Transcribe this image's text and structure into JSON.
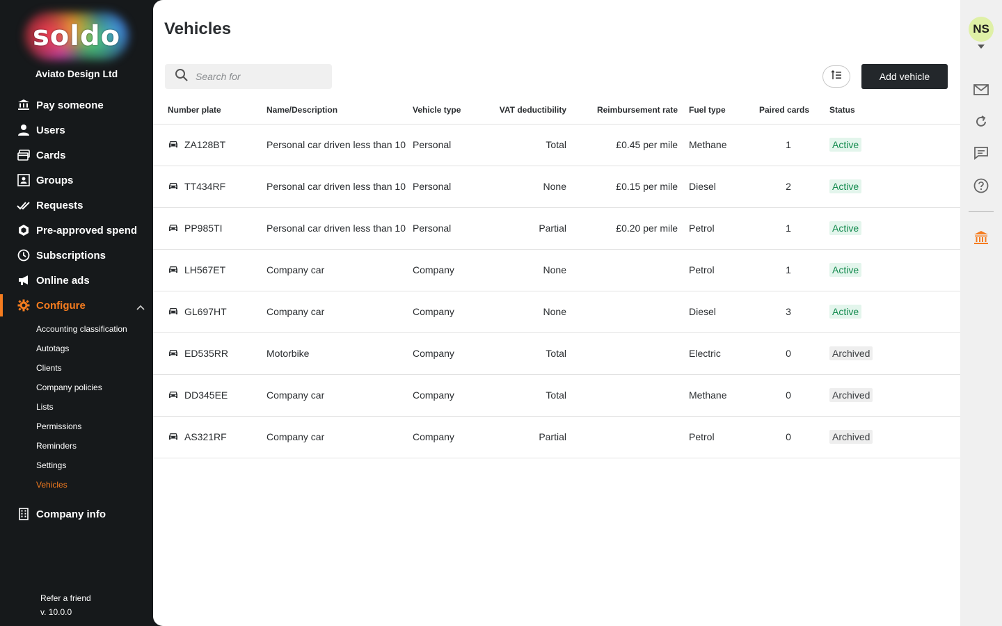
{
  "brand": {
    "logo": "soldo",
    "company": "Aviato Design Ltd",
    "accent": "#f57c1f"
  },
  "nav": {
    "items": [
      {
        "label": "Pay someone",
        "icon": "bank-transfer-icon"
      },
      {
        "label": "Users",
        "icon": "user-icon"
      },
      {
        "label": "Cards",
        "icon": "cards-icon"
      },
      {
        "label": "Groups",
        "icon": "groups-icon"
      },
      {
        "label": "Requests",
        "icon": "double-check-icon"
      },
      {
        "label": "Pre-approved spend",
        "icon": "hexagon-icon"
      },
      {
        "label": "Subscriptions",
        "icon": "clock-icon"
      },
      {
        "label": "Online ads",
        "icon": "megaphone-icon"
      }
    ],
    "configure": {
      "label": "Configure",
      "icon": "gear-icon"
    },
    "sub_items": [
      "Accounting classification",
      "Autotags",
      "Clients",
      "Company policies",
      "Lists",
      "Permissions",
      "Reminders",
      "Settings",
      "Vehicles"
    ],
    "company_info": {
      "label": "Company info",
      "icon": "building-icon"
    }
  },
  "footer": {
    "refer": "Refer a friend",
    "version": "v. 10.0.0"
  },
  "page": {
    "title": "Vehicles",
    "search_placeholder": "Search for",
    "add_button": "Add vehicle"
  },
  "table": {
    "columns": {
      "plate": "Number plate",
      "name": "Name/Description",
      "type": "Vehicle type",
      "vat": "VAT deductibility",
      "rate": "Reimbursement rate",
      "fuel": "Fuel type",
      "paired": "Paired cards",
      "status": "Status"
    },
    "rows": [
      {
        "plate": "ZA128BT",
        "name": "Personal car driven less than 10",
        "type": "Personal",
        "vat": "Total",
        "rate": "£0.45 per mile",
        "fuel": "Methane",
        "paired": "1",
        "status": "Active"
      },
      {
        "plate": "TT434RF",
        "name": "Personal car driven less than 10",
        "type": "Personal",
        "vat": "None",
        "rate": "£0.15 per mile",
        "fuel": "Diesel",
        "paired": "2",
        "status": "Active"
      },
      {
        "plate": "PP985TI",
        "name": "Personal car driven less than 10",
        "type": "Personal",
        "vat": "Partial",
        "rate": "£0.20 per mile",
        "fuel": "Petrol",
        "paired": "1",
        "status": "Active"
      },
      {
        "plate": "LH567ET",
        "name": "Company car",
        "type": "Company",
        "vat": "None",
        "rate": "",
        "fuel": "Petrol",
        "paired": "1",
        "status": "Active"
      },
      {
        "plate": "GL697HT",
        "name": "Company car",
        "type": "Company",
        "vat": "None",
        "rate": "",
        "fuel": "Diesel",
        "paired": "3",
        "status": "Active"
      },
      {
        "plate": "ED535RR",
        "name": "Motorbike",
        "type": "Company",
        "vat": "Total",
        "rate": "",
        "fuel": "Electric",
        "paired": "0",
        "status": "Archived"
      },
      {
        "plate": "DD345EE",
        "name": "Company car",
        "type": "Company",
        "vat": "Total",
        "rate": "",
        "fuel": "Methane",
        "paired": "0",
        "status": "Archived"
      },
      {
        "plate": "AS321RF",
        "name": "Company car",
        "type": "Company",
        "vat": "Partial",
        "rate": "",
        "fuel": "Petrol",
        "paired": "0",
        "status": "Archived"
      }
    ]
  },
  "rail": {
    "avatar": "NS"
  }
}
